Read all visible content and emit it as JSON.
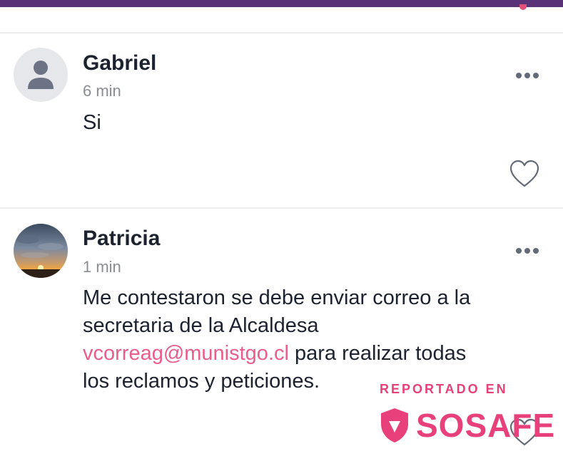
{
  "comments": [
    {
      "author": "Gabriel",
      "time": "6 min",
      "text": "Si",
      "avatar": "default-user-avatar"
    },
    {
      "author": "Patricia",
      "time": "1 min",
      "text_line1": "Me contestaron se debe enviar correo a la",
      "text_line2": "secretaria de la Alcaldesa",
      "email": "vcorreag@munistgo.cl",
      "text_after_email": " para realizar todas",
      "text_line4": "los reclamos y peticiones.",
      "avatar": "sunset-photo-avatar"
    }
  ],
  "watermark": {
    "label": "REPORTADO EN",
    "brand": "SOSAFE"
  },
  "colors": {
    "top_bar": "#5a3278",
    "link": "#e85d8c",
    "brand": "#e8407a",
    "icon": "#646a78"
  },
  "icons": [
    "more-options-icon",
    "heart-icon",
    "user-icon",
    "shield-icon"
  ]
}
